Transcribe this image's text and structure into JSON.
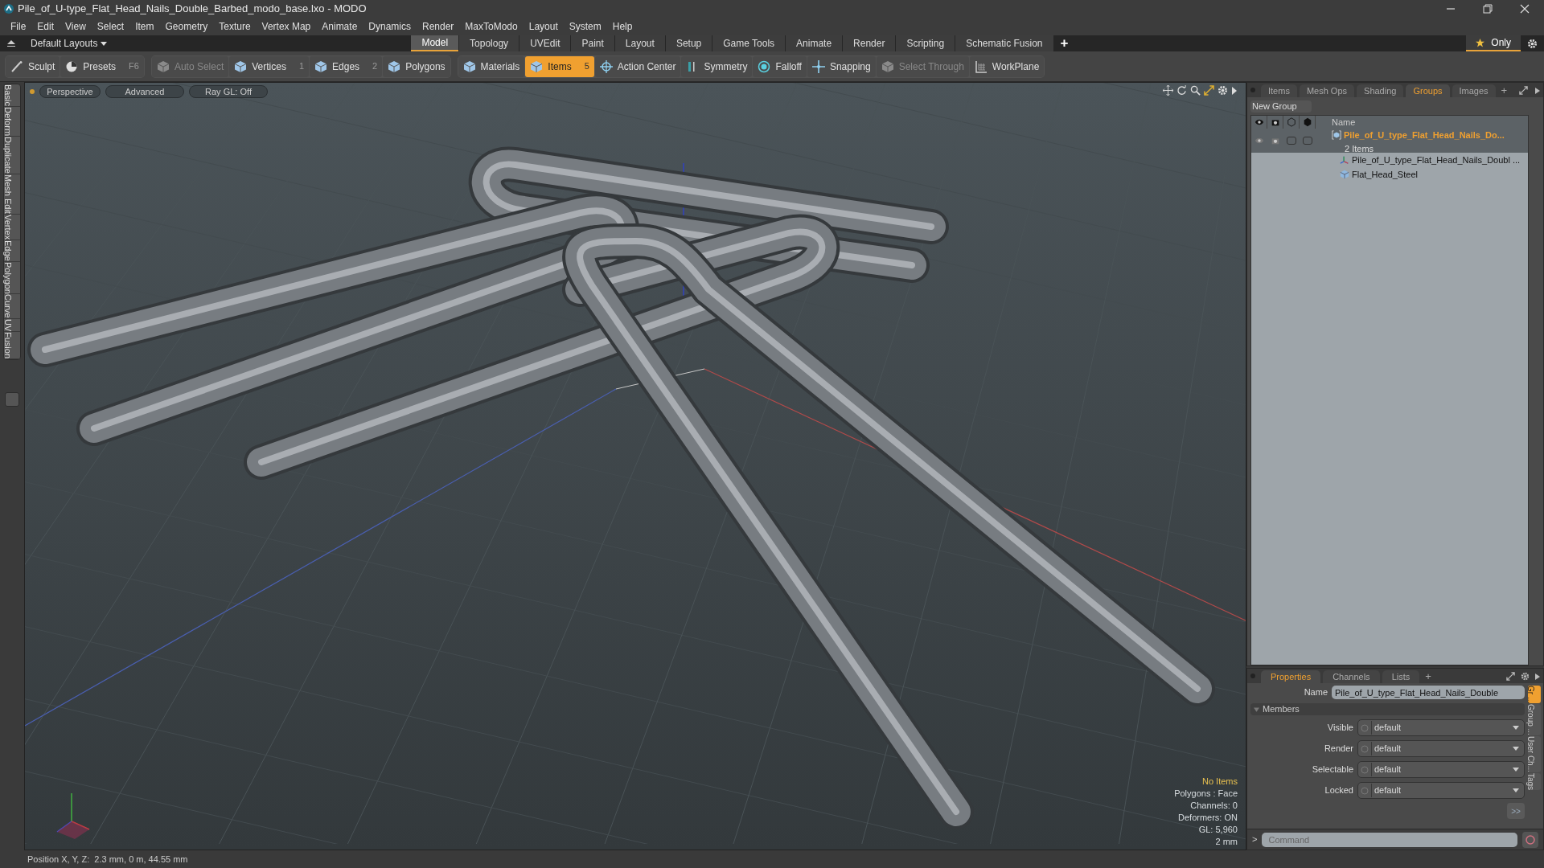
{
  "window": {
    "title": "Pile_of_U-type_Flat_Head_Nails_Double_Barbed_modo_base.lxo - MODO"
  },
  "menu": [
    "File",
    "Edit",
    "View",
    "Select",
    "Item",
    "Geometry",
    "Texture",
    "Vertex Map",
    "Animate",
    "Dynamics",
    "Render",
    "MaxToModo",
    "Layout",
    "System",
    "Help"
  ],
  "layout_bar": {
    "dropdown": "Default Layouts",
    "tabs": [
      {
        "label": "Model",
        "selected": true
      },
      {
        "label": "Topology",
        "selected": false
      },
      {
        "label": "UVEdit",
        "selected": false
      },
      {
        "label": "Paint",
        "selected": false
      },
      {
        "label": "Layout",
        "selected": false
      },
      {
        "label": "Setup",
        "selected": false
      },
      {
        "label": "Game Tools",
        "selected": false
      },
      {
        "label": "Animate",
        "selected": false
      },
      {
        "label": "Render",
        "selected": false
      },
      {
        "label": "Scripting",
        "selected": false
      },
      {
        "label": "Schematic Fusion",
        "selected": false
      }
    ],
    "add": "+",
    "only": "Only"
  },
  "toolbar": [
    {
      "label": "Sculpt",
      "kind": "brush",
      "selected": false,
      "disabled": false
    },
    {
      "label": "Presets",
      "shortcut": "F6",
      "kind": "presets",
      "selected": false,
      "disabled": false
    },
    {
      "label": "Auto Select",
      "kind": "cube",
      "selected": false,
      "disabled": true
    },
    {
      "label": "Vertices",
      "shortcut": "1",
      "kind": "cube",
      "selected": false,
      "disabled": false
    },
    {
      "label": "Edges",
      "shortcut": "2",
      "kind": "cube",
      "selected": false,
      "disabled": false
    },
    {
      "label": "Polygons",
      "kind": "cube",
      "selected": false,
      "disabled": false
    },
    {
      "label": "Materials",
      "kind": "cube",
      "selected": false,
      "disabled": false
    },
    {
      "label": "Items",
      "shortcut": "5",
      "kind": "cube",
      "selected": true,
      "disabled": false
    },
    {
      "label": "Action Center",
      "kind": "target",
      "selected": false,
      "disabled": false
    },
    {
      "label": "Symmetry",
      "kind": "symmetry",
      "selected": false,
      "disabled": false
    },
    {
      "label": "Falloff",
      "kind": "falloff",
      "selected": false,
      "disabled": false
    },
    {
      "label": "Snapping",
      "kind": "snap",
      "selected": false,
      "disabled": false
    },
    {
      "label": "Select Through",
      "kind": "cube",
      "selected": false,
      "disabled": true
    },
    {
      "label": "WorkPlane",
      "kind": "grid",
      "selected": false,
      "disabled": false
    }
  ],
  "left_tabs": [
    "Basic",
    "Deform",
    "Duplicate",
    "Mesh Edit",
    "Vertex",
    "Edge",
    "Polygon",
    "Curve",
    "UV",
    "Fusion"
  ],
  "viewport": {
    "header": [
      "Perspective",
      "Advanced",
      "Ray GL: Off"
    ],
    "info": [
      {
        "text": "No Items",
        "kind": "highlight"
      },
      {
        "text": "Polygons : Face",
        "kind": "normal"
      },
      {
        "text": "Channels: 0",
        "kind": "normal"
      },
      {
        "text": "Deformers: ON",
        "kind": "normal"
      },
      {
        "text": "GL: 5,960",
        "kind": "normal"
      },
      {
        "text": "2 mm",
        "kind": "normal"
      }
    ]
  },
  "scene_panel": {
    "tabs": [
      {
        "label": "Items",
        "selected": false
      },
      {
        "label": "Mesh Ops",
        "selected": false
      },
      {
        "label": "Shading",
        "selected": false
      },
      {
        "label": "Groups",
        "selected": true
      },
      {
        "label": "Images",
        "selected": false
      }
    ],
    "add": "+",
    "new_group": "New Group",
    "name_column": "Name",
    "groups": [
      {
        "name": "Pile_of_U_type_Flat_Head_Nails_Do...",
        "count": "2 Items",
        "selected": true,
        "children": [
          {
            "name": "Pile_of_U_type_Flat_Head_Nails_Doubl ...",
            "kind": "locator"
          },
          {
            "name": "Flat_Head_Steel",
            "kind": "mesh"
          }
        ]
      }
    ]
  },
  "properties": {
    "tabs": [
      {
        "label": "Properties",
        "selected": true
      },
      {
        "label": "Channels",
        "selected": false
      },
      {
        "label": "Lists",
        "selected": false
      }
    ],
    "add": "+",
    "name_label": "Name",
    "name_value": "Pile_of_U_type_Flat_Head_Nails_Double",
    "section": {
      "label": "Members",
      "expanded": true
    },
    "fields": [
      {
        "label": "Visible",
        "value": "default"
      },
      {
        "label": "Render",
        "value": "default"
      },
      {
        "label": "Selectable",
        "value": "default"
      },
      {
        "label": "Locked",
        "value": "default"
      }
    ],
    "more": ">>",
    "side_tabs": [
      {
        "label": "Gr ...",
        "selected": true
      },
      {
        "label": "Group ...",
        "selected": false
      },
      {
        "label": "User Ch...",
        "selected": false
      },
      {
        "label": "Tags",
        "selected": false
      }
    ]
  },
  "command": {
    "prompt": ">",
    "placeholder": "Command"
  },
  "status_bar": "Position X, Y, Z:  2.3 mm, 0 m, 44.55 mm"
}
